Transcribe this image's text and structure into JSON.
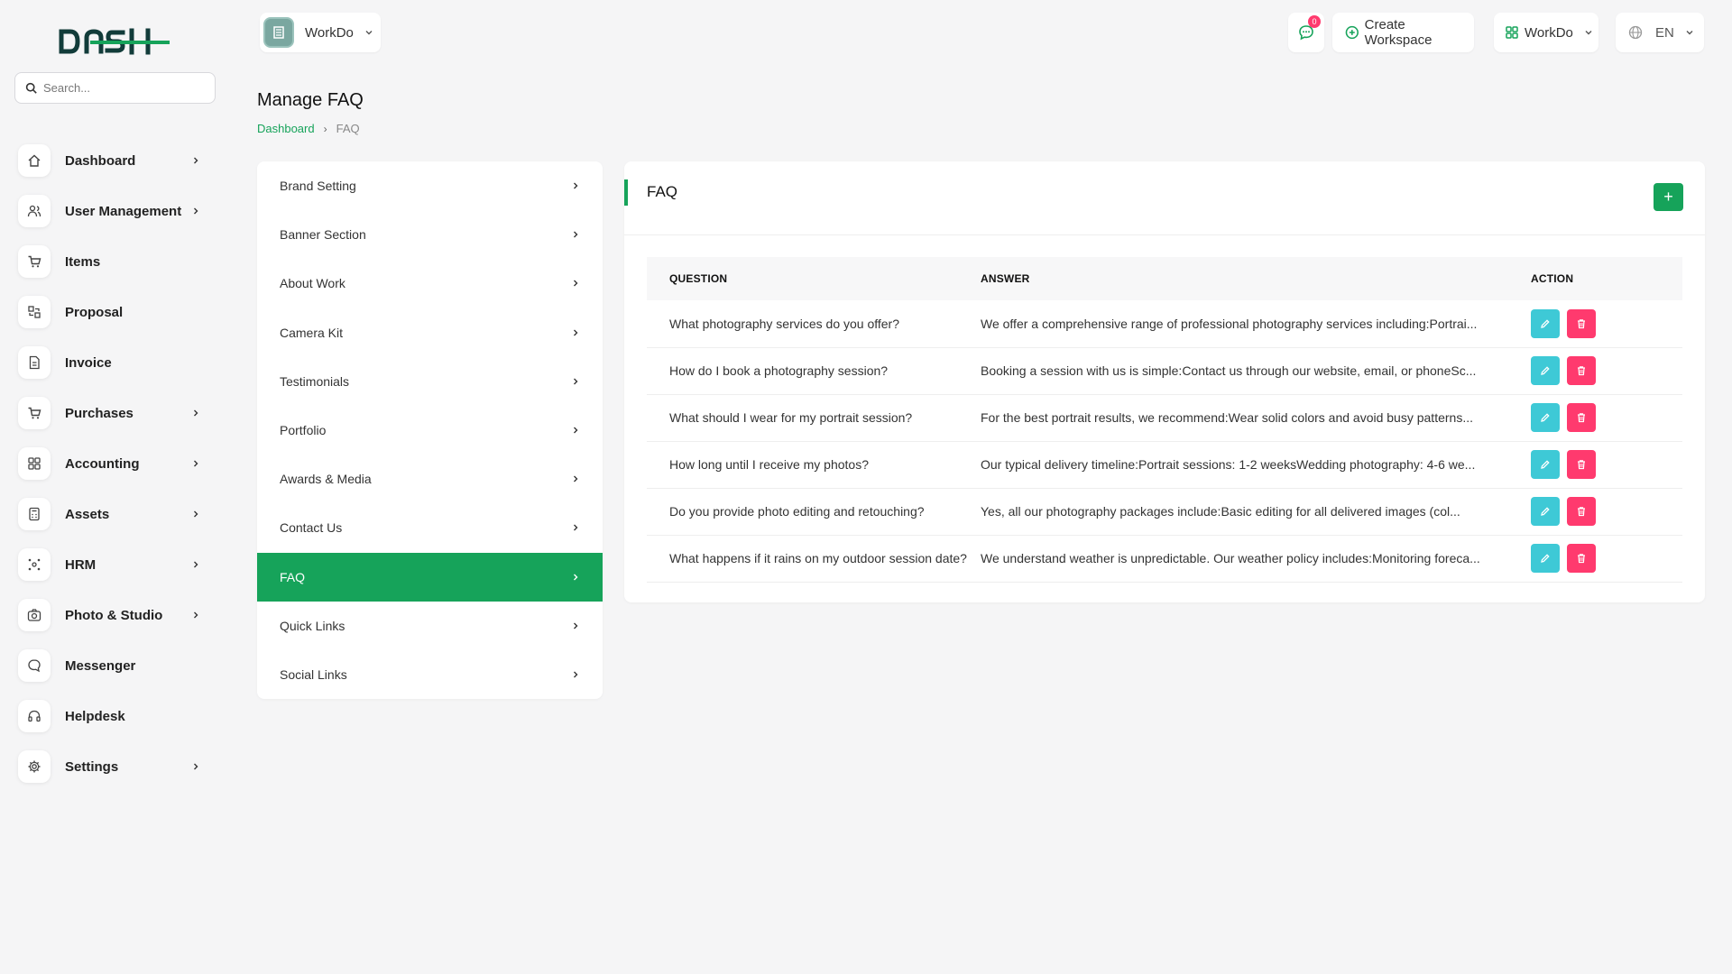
{
  "search": {
    "placeholder": "Search..."
  },
  "sidebar": {
    "items": [
      {
        "label": "Dashboard",
        "icon": "home-icon",
        "has_submenu": true
      },
      {
        "label": "User Management",
        "icon": "users-icon",
        "has_submenu": true
      },
      {
        "label": "Items",
        "icon": "cart-icon",
        "has_submenu": false
      },
      {
        "label": "Proposal",
        "icon": "proposal-icon",
        "has_submenu": false
      },
      {
        "label": "Invoice",
        "icon": "invoice-icon",
        "has_submenu": false
      },
      {
        "label": "Purchases",
        "icon": "cart-icon",
        "has_submenu": true
      },
      {
        "label": "Accounting",
        "icon": "grid-icon",
        "has_submenu": true
      },
      {
        "label": "Assets",
        "icon": "calculator-icon",
        "has_submenu": true
      },
      {
        "label": "HRM",
        "icon": "hrm-icon",
        "has_submenu": true
      },
      {
        "label": "Photo & Studio",
        "icon": "camera-icon",
        "has_submenu": true
      },
      {
        "label": "Messenger",
        "icon": "chat-icon",
        "has_submenu": false
      },
      {
        "label": "Helpdesk",
        "icon": "headset-icon",
        "has_submenu": false
      },
      {
        "label": "Settings",
        "icon": "gear-icon",
        "has_submenu": true
      }
    ]
  },
  "header": {
    "workspace": "WorkDo",
    "notification_count": "0",
    "create_workspace": "Create Workspace",
    "workspace_menu": "WorkDo",
    "language": "EN"
  },
  "page": {
    "title": "Manage FAQ",
    "breadcrumb": {
      "home": "Dashboard",
      "current": "FAQ"
    }
  },
  "settings_menu": {
    "items": [
      {
        "label": "Brand Setting",
        "active": false
      },
      {
        "label": "Banner Section",
        "active": false
      },
      {
        "label": "About Work",
        "active": false
      },
      {
        "label": "Camera Kit",
        "active": false
      },
      {
        "label": "Testimonials",
        "active": false
      },
      {
        "label": "Portfolio",
        "active": false
      },
      {
        "label": "Awards & Media",
        "active": false
      },
      {
        "label": "Contact Us",
        "active": false
      },
      {
        "label": "FAQ",
        "active": true
      },
      {
        "label": "Quick Links",
        "active": false
      },
      {
        "label": "Social Links",
        "active": false
      }
    ]
  },
  "faq": {
    "title": "FAQ",
    "add_label": "+",
    "columns": {
      "question": "QUESTION",
      "answer": "ANSWER",
      "action": "ACTION"
    },
    "rows": [
      {
        "question": "What photography services do you offer?",
        "answer": "We offer a comprehensive range of professional photography services including:Portrai..."
      },
      {
        "question": "How do I book a photography session?",
        "answer": "Booking a session with us is simple:Contact us through our website, email, or phoneSc..."
      },
      {
        "question": "What should I wear for my portrait session?",
        "answer": "For the best portrait results, we recommend:Wear solid colors and avoid busy patterns..."
      },
      {
        "question": "How long until I receive my photos?",
        "answer": "Our typical delivery timeline:Portrait sessions: 1-2 weeksWedding photography: 4-6 we..."
      },
      {
        "question": "Do you provide photo editing and retouching?",
        "answer": "Yes, all our photography packages include:Basic editing for all delivered images (col..."
      },
      {
        "question": "What happens if it rains on my outdoor session date?",
        "answer": "We understand weather is unpredictable. Our weather policy includes:Monitoring foreca..."
      }
    ]
  },
  "colors": {
    "accent": "#16a35a",
    "edit": "#3ec9d6",
    "delete": "#ff3a6e",
    "badge": "#ff3a6e"
  }
}
